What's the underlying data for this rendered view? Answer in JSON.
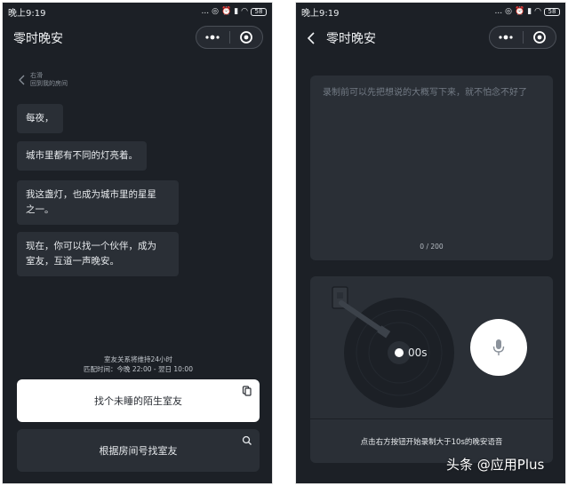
{
  "left": {
    "status": {
      "time": "晚上9:19",
      "dots": "...",
      "battery": "58"
    },
    "title": "零时晚安",
    "return": {
      "line1": "右滑",
      "line2": "回到我的房间"
    },
    "messages": [
      "每夜，",
      "城市里都有不同的灯亮着。",
      "我这盏灯，也成为城市里的星星\n之一。",
      "现在，你可以找一个伙伴，成为\n室友，互道一声晚安。"
    ],
    "notice": {
      "line1": "室友关系将维持24小时",
      "line2": "匹配时间：今晚 22:00 - 翌日 10:00"
    },
    "buttons": {
      "stranger": "找个未睡的陌生室友",
      "room_number": "根据房间号找室友"
    }
  },
  "right": {
    "status": {
      "time": "晚上9:19",
      "dots": "...",
      "battery": "58"
    },
    "title": "零时晚安",
    "draft_placeholder": "录制前可以先把想说的大概写下来，就不怕念不好了",
    "counter": "0 / 200",
    "timer": "00s",
    "hint": "点击右方按钮开始录制大于10s的晚安语音"
  },
  "watermark": "头条 @应用Plus",
  "colors": {
    "background": "#1c2026",
    "card": "#2a2f36",
    "text": "#e7eaed",
    "muted": "#737b85"
  }
}
